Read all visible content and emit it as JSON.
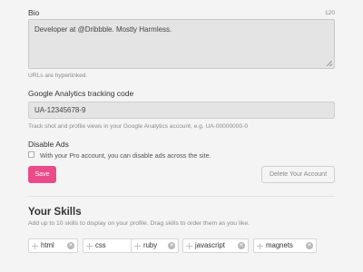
{
  "bio": {
    "label": "Bio",
    "counter": "120",
    "value": "Developer at @Dribbble. Mostly Harmless.",
    "help": "URLs are hyperlinked."
  },
  "analytics": {
    "label": "Google Analytics tracking code",
    "value": "UA-12345678-9",
    "help": "Track shot and profile views in your Google Analytics account, e.g. UA-00000000-0"
  },
  "ads": {
    "label": "Disable Ads",
    "checkbox_label": "With your Pro account, you can disable ads across the site.",
    "checked": false
  },
  "actions": {
    "save_label": "Save",
    "delete_label": "Delete Your Account",
    "save_color": "#ea4c89"
  },
  "skills": {
    "heading": "Your Skills",
    "help": "Add up to 10 skills to display on your profile. Drag skills to order them as you like.",
    "items": [
      {
        "label": "html"
      },
      {
        "label": "css"
      },
      {
        "label": "ruby"
      },
      {
        "label": "javascript"
      },
      {
        "label": "magnets"
      }
    ],
    "drag_icon": "drag-handle-icon",
    "remove_icon": "remove-icon"
  }
}
